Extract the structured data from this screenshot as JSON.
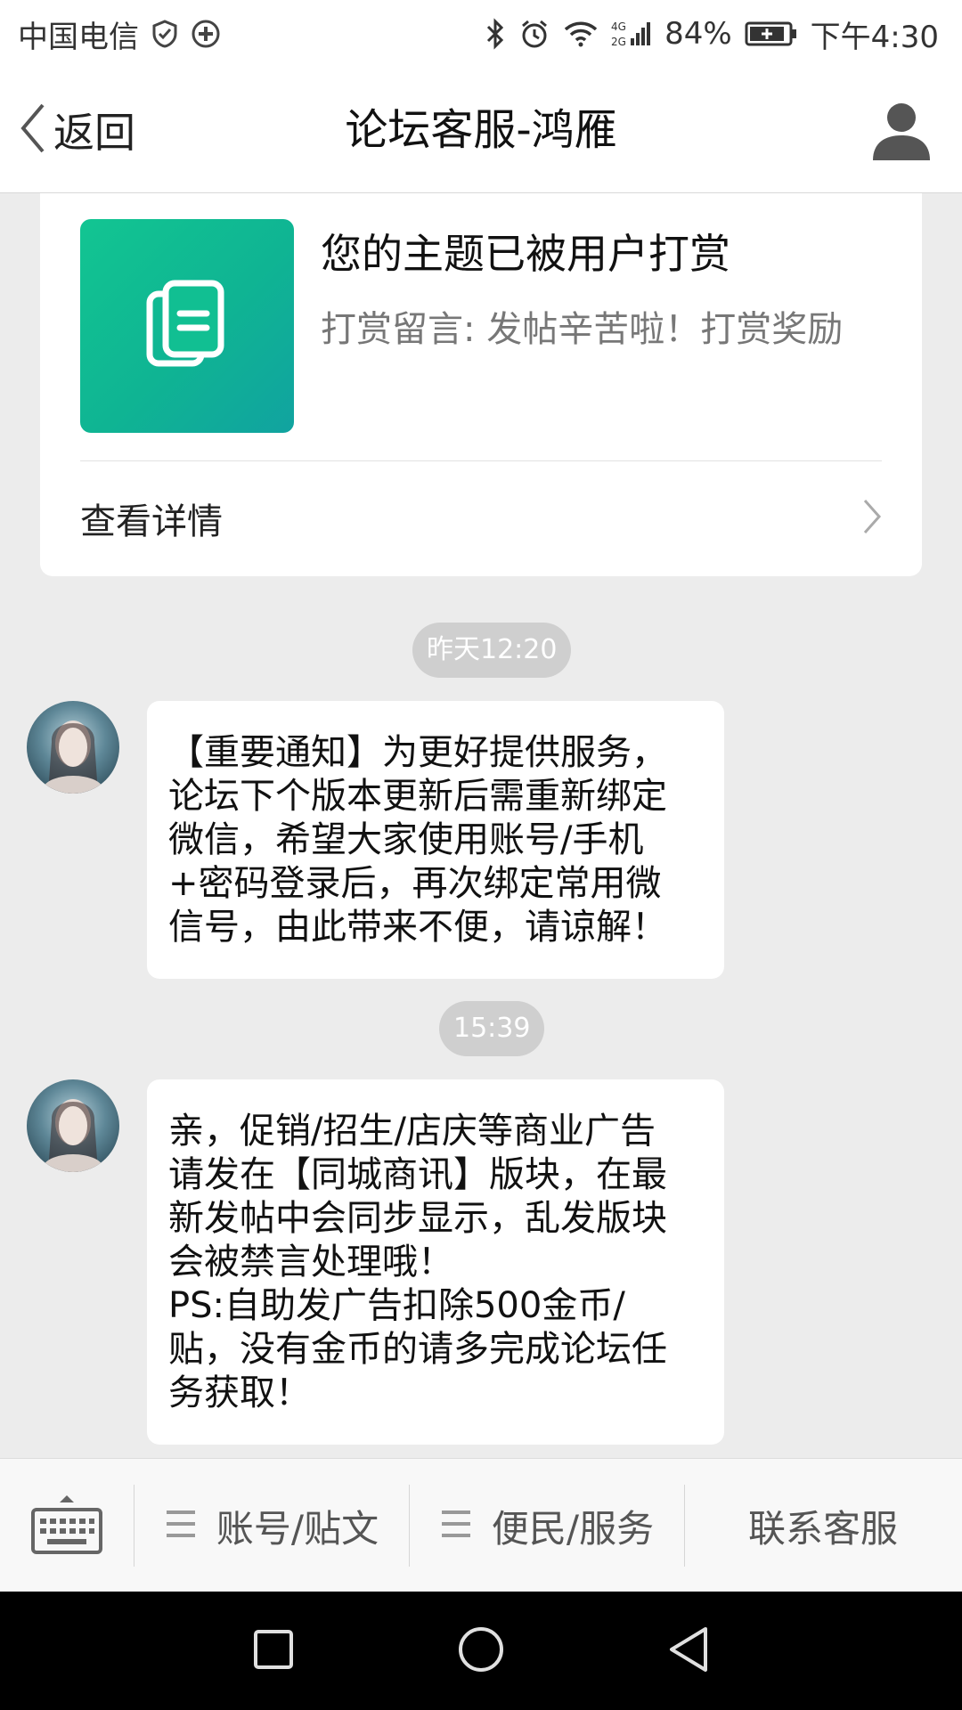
{
  "status_bar": {
    "carrier": "中国电信",
    "network": "4G 2G",
    "battery": "84%",
    "time": "下午4:30"
  },
  "nav": {
    "back_label": "返回",
    "title": "论坛客服-鸿雁",
    "profile_icon": "person-icon"
  },
  "card": {
    "title": "您的主题已被用户打赏",
    "description": "打赏留言: 发帖辛苦啦！打赏奖励",
    "action_label": "查看详情",
    "thumb_icon": "document-icon",
    "thumb_color": "#12c592"
  },
  "messages": [
    {
      "timestamp": "昨天12:20",
      "text": "【重要通知】为更好提供服务，\n论坛下个版本更新后需重新绑定\n微信，希望大家使用账号/手机\n+密码登录后，再次绑定常用微\n信号，由此带来不便，请谅解！"
    },
    {
      "timestamp": "15:39",
      "text": "亲，促销/招生/店庆等商业广告\n请发在【同城商讯】版块，在最\n新发帖中会同步显示，乱发版块\n会被禁言处理哦！\nPS:自助发广告扣除500金币/\n贴，没有金币的请多完成论坛任\n务获取！"
    }
  ],
  "bottom_menu": {
    "keyboard_icon": "keyboard-icon",
    "items": [
      {
        "label": "账号/贴文",
        "icon": "menu-lines-icon"
      },
      {
        "label": "便民/服务",
        "icon": "menu-lines-icon"
      },
      {
        "label": "联系客服"
      }
    ]
  },
  "system_nav": {
    "buttons": [
      "square-icon",
      "circle-icon",
      "triangle-back-icon"
    ]
  },
  "colors": {
    "background": "#ececec",
    "time_pill": "#cfcfcf",
    "accent_green": "#12c592"
  }
}
